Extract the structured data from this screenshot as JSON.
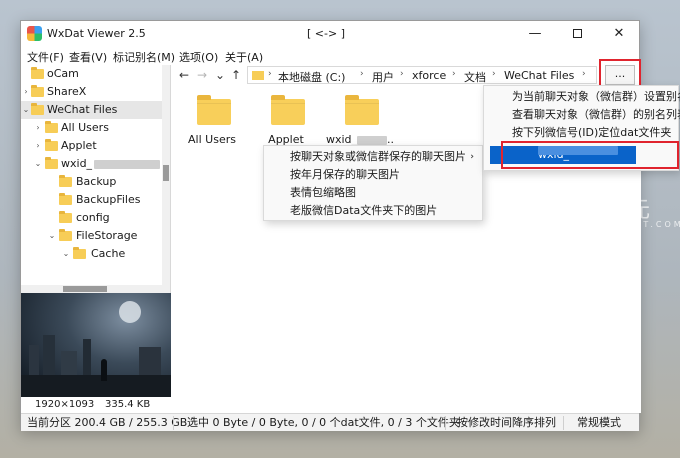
{
  "window": {
    "app_title": "WxDat Viewer 2.5",
    "center_title": "[ <-> ]",
    "minimize": "—",
    "close": "✕"
  },
  "menu": {
    "file": "文件(F)",
    "view": "查看(V)",
    "alias": "标记别名(M)",
    "options": "选项(O)",
    "about": "关于(A)"
  },
  "tree": {
    "items": [
      {
        "label": "oCam"
      },
      {
        "label": "ShareX"
      },
      {
        "label": "WeChat Files"
      },
      {
        "label": "All Users"
      },
      {
        "label": "Applet"
      },
      {
        "label": "wxid_"
      },
      {
        "label": "Backup"
      },
      {
        "label": "BackupFiles"
      },
      {
        "label": "config"
      },
      {
        "label": "FileStorage"
      },
      {
        "label": "Cache"
      }
    ]
  },
  "preview": {
    "resolution": "1920×1093",
    "size": "335.4 KB"
  },
  "address": {
    "back": "←",
    "forward": "→",
    "dropdown": "⌄",
    "up": "↑",
    "crumbs": [
      "本地磁盘 (C:)",
      "用户",
      "xforce",
      "文档",
      "WeChat Files"
    ],
    "more": "..."
  },
  "files": [
    {
      "label": "All Users"
    },
    {
      "label": "Applet"
    },
    {
      "label": "wxid_"
    }
  ],
  "context_menu_left": {
    "items": [
      "按聊天对象或微信群保存的聊天图片",
      "按年月保存的聊天图片",
      "表情包缩略图",
      "老版微信Data文件夹下的图片"
    ]
  },
  "context_menu_right": {
    "items": [
      "为当前聊天对象（微信群）设置别名",
      "查看聊天对象（微信群）的别名列表",
      "按下列微信号(ID)定位dat文件夹",
      "wxid_"
    ]
  },
  "status": {
    "partition": "当前分区 200.4 GB / 255.3 GB",
    "selection": "选中 0 Byte / 0 Byte, 0 / 0 个dat文件, 0 / 3 个文件夹",
    "sort": "按修改时间降序排列",
    "mode": "常规模式"
  },
  "watermark": {
    "title": "异次元",
    "subtitle": "IPLAYSOFT.COM"
  },
  "colors": {
    "selection_blue": "#0a63c9",
    "highlight_red": "#e0242e",
    "folder_yellow": "#f7cd57"
  }
}
